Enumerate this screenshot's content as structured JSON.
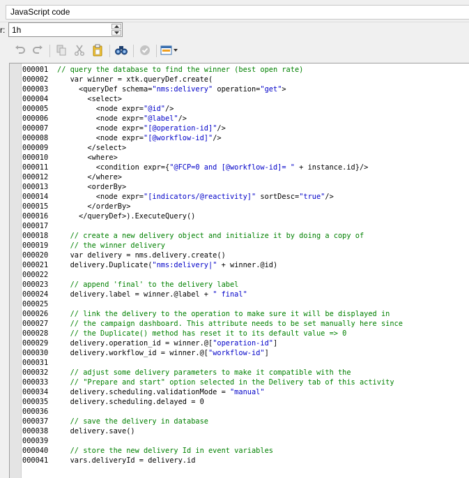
{
  "editor_title": "JavaScript code",
  "timeout": {
    "label": "r:",
    "value": "1h"
  },
  "toolbar": {
    "buttons": [
      "undo-icon",
      "redo-icon",
      "copy-icon",
      "cut-icon",
      "paste-icon",
      "find-icon",
      "check-syntax-icon",
      "insert-field-icon"
    ]
  },
  "colors": {
    "comment": "#008000",
    "string": "#0000c8",
    "code": "#000000"
  },
  "lines": [
    {
      "n": "000001",
      "indent": "",
      "parts": [
        {
          "t": "c",
          "v": "// query the database to find the winner (best open rate)"
        }
      ]
    },
    {
      "n": "000002",
      "indent": "   ",
      "parts": [
        {
          "t": "p",
          "v": "var winner = xtk.queryDef.create("
        }
      ]
    },
    {
      "n": "000003",
      "indent": "     ",
      "parts": [
        {
          "t": "p",
          "v": "<queryDef schema="
        },
        {
          "t": "s",
          "v": "\"nms:delivery\""
        },
        {
          "t": "p",
          "v": " operation="
        },
        {
          "t": "s",
          "v": "\"get\""
        },
        {
          "t": "p",
          "v": ">"
        }
      ]
    },
    {
      "n": "000004",
      "indent": "       ",
      "parts": [
        {
          "t": "p",
          "v": "<select>"
        }
      ]
    },
    {
      "n": "000005",
      "indent": "         ",
      "parts": [
        {
          "t": "p",
          "v": "<node expr="
        },
        {
          "t": "s",
          "v": "\"@id\""
        },
        {
          "t": "p",
          "v": "/>"
        }
      ]
    },
    {
      "n": "000006",
      "indent": "         ",
      "parts": [
        {
          "t": "p",
          "v": "<node expr="
        },
        {
          "t": "s",
          "v": "\"@label\""
        },
        {
          "t": "p",
          "v": "/>"
        }
      ]
    },
    {
      "n": "000007",
      "indent": "         ",
      "parts": [
        {
          "t": "p",
          "v": "<node expr="
        },
        {
          "t": "s",
          "v": "\"[@operation-id]\""
        },
        {
          "t": "p",
          "v": "/>"
        }
      ]
    },
    {
      "n": "000008",
      "indent": "         ",
      "parts": [
        {
          "t": "p",
          "v": "<node expr="
        },
        {
          "t": "s",
          "v": "\"[@workflow-id]\""
        },
        {
          "t": "p",
          "v": "/>"
        }
      ]
    },
    {
      "n": "000009",
      "indent": "       ",
      "parts": [
        {
          "t": "p",
          "v": "</select>"
        }
      ]
    },
    {
      "n": "000010",
      "indent": "       ",
      "parts": [
        {
          "t": "p",
          "v": "<where>"
        }
      ]
    },
    {
      "n": "000011",
      "indent": "         ",
      "parts": [
        {
          "t": "p",
          "v": "<condition expr={"
        },
        {
          "t": "s",
          "v": "\"@FCP=0 and [@workflow-id]= \""
        },
        {
          "t": "p",
          "v": " + instance.id}/>"
        }
      ]
    },
    {
      "n": "000012",
      "indent": "       ",
      "parts": [
        {
          "t": "p",
          "v": "</where>"
        }
      ]
    },
    {
      "n": "000013",
      "indent": "       ",
      "parts": [
        {
          "t": "p",
          "v": "<orderBy>"
        }
      ]
    },
    {
      "n": "000014",
      "indent": "         ",
      "parts": [
        {
          "t": "p",
          "v": "<node expr="
        },
        {
          "t": "s",
          "v": "\"[indicators/@reactivity]\""
        },
        {
          "t": "p",
          "v": " sortDesc="
        },
        {
          "t": "s",
          "v": "\"true\""
        },
        {
          "t": "p",
          "v": "/>"
        }
      ]
    },
    {
      "n": "000015",
      "indent": "       ",
      "parts": [
        {
          "t": "p",
          "v": "</orderBy>"
        }
      ]
    },
    {
      "n": "000016",
      "indent": "     ",
      "parts": [
        {
          "t": "p",
          "v": "</queryDef>).ExecuteQuery()"
        }
      ]
    },
    {
      "n": "000017",
      "indent": "",
      "parts": []
    },
    {
      "n": "000018",
      "indent": "   ",
      "parts": [
        {
          "t": "c",
          "v": "// create a new delivery object and initialize it by doing a copy of"
        }
      ]
    },
    {
      "n": "000019",
      "indent": "   ",
      "parts": [
        {
          "t": "c",
          "v": "// the winner delivery"
        }
      ]
    },
    {
      "n": "000020",
      "indent": "   ",
      "parts": [
        {
          "t": "p",
          "v": "var delivery = nms.delivery.create()"
        }
      ]
    },
    {
      "n": "000021",
      "indent": "   ",
      "parts": [
        {
          "t": "p",
          "v": "delivery.Duplicate("
        },
        {
          "t": "s",
          "v": "\"nms:delivery|\""
        },
        {
          "t": "p",
          "v": " + winner.@id)"
        }
      ]
    },
    {
      "n": "000022",
      "indent": "",
      "parts": []
    },
    {
      "n": "000023",
      "indent": "   ",
      "parts": [
        {
          "t": "c",
          "v": "// append 'final' to the delivery label"
        }
      ]
    },
    {
      "n": "000024",
      "indent": "   ",
      "parts": [
        {
          "t": "p",
          "v": "delivery.label = winner.@label + "
        },
        {
          "t": "s",
          "v": "\" final\""
        }
      ]
    },
    {
      "n": "000025",
      "indent": "",
      "parts": []
    },
    {
      "n": "000026",
      "indent": "   ",
      "parts": [
        {
          "t": "c",
          "v": "// link the delivery to the operation to make sure it will be displayed in"
        }
      ]
    },
    {
      "n": "000027",
      "indent": "   ",
      "parts": [
        {
          "t": "c",
          "v": "// the campaign dashboard. This attribute needs to be set manually here since"
        }
      ]
    },
    {
      "n": "000028",
      "indent": "   ",
      "parts": [
        {
          "t": "c",
          "v": "// the Duplicate() method has reset it to its default value => 0"
        }
      ]
    },
    {
      "n": "000029",
      "indent": "   ",
      "parts": [
        {
          "t": "p",
          "v": "delivery.operation_id = winner.@["
        },
        {
          "t": "s",
          "v": "\"operation-id\""
        },
        {
          "t": "p",
          "v": "]"
        }
      ]
    },
    {
      "n": "000030",
      "indent": "   ",
      "parts": [
        {
          "t": "p",
          "v": "delivery.workflow_id = winner.@["
        },
        {
          "t": "s",
          "v": "\"workflow-id\""
        },
        {
          "t": "p",
          "v": "]"
        }
      ]
    },
    {
      "n": "000031",
      "indent": "",
      "parts": []
    },
    {
      "n": "000032",
      "indent": "   ",
      "parts": [
        {
          "t": "c",
          "v": "// adjust some delivery parameters to make it compatible with the"
        }
      ]
    },
    {
      "n": "000033",
      "indent": "   ",
      "parts": [
        {
          "t": "c",
          "v": "// \"Prepare and start\" option selected in the Delivery tab of this activity"
        }
      ]
    },
    {
      "n": "000034",
      "indent": "   ",
      "parts": [
        {
          "t": "p",
          "v": "delivery.scheduling.validationMode = "
        },
        {
          "t": "s",
          "v": "\"manual\""
        }
      ]
    },
    {
      "n": "000035",
      "indent": "   ",
      "parts": [
        {
          "t": "p",
          "v": "delivery.scheduling.delayed = 0"
        }
      ]
    },
    {
      "n": "000036",
      "indent": "",
      "parts": []
    },
    {
      "n": "000037",
      "indent": "   ",
      "parts": [
        {
          "t": "c",
          "v": "// save the delivery in database"
        }
      ]
    },
    {
      "n": "000038",
      "indent": "   ",
      "parts": [
        {
          "t": "p",
          "v": "delivery.save()"
        }
      ]
    },
    {
      "n": "000039",
      "indent": "",
      "parts": []
    },
    {
      "n": "000040",
      "indent": "   ",
      "parts": [
        {
          "t": "c",
          "v": "// store the new delivery Id in event variables"
        }
      ]
    },
    {
      "n": "000041",
      "indent": "   ",
      "parts": [
        {
          "t": "p",
          "v": "vars.deliveryId = delivery.id"
        }
      ]
    }
  ]
}
